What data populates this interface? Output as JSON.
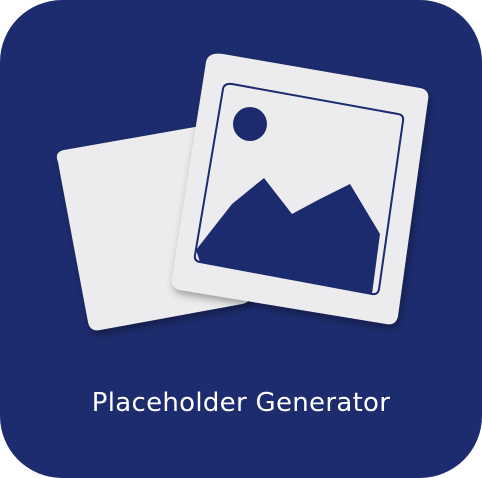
{
  "app": {
    "name": "Placeholder Generator",
    "icon": "photo-placeholder-icon"
  },
  "colors": {
    "background": "#1d2c6e",
    "card": "#ececee",
    "card_border": "#c9cbd2",
    "text": "#ffffff"
  }
}
